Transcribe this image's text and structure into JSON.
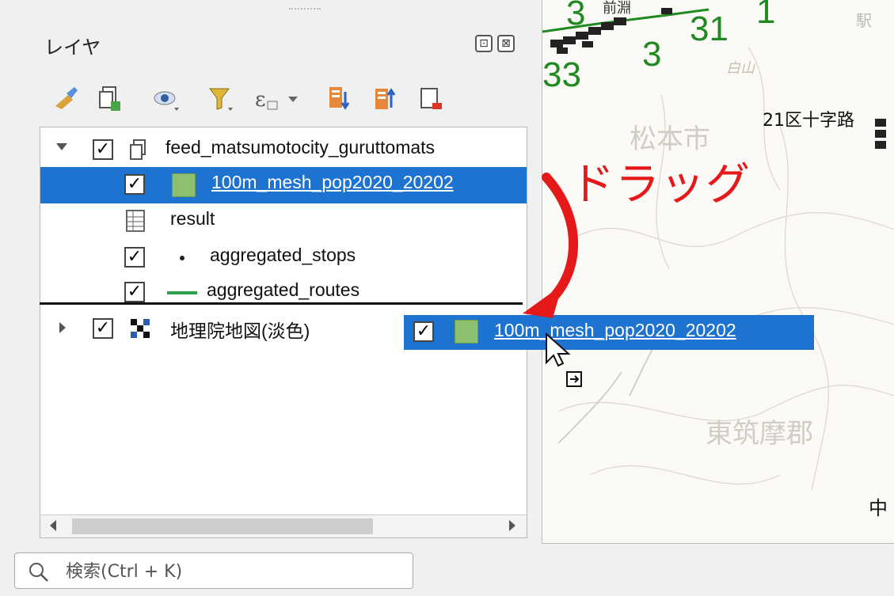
{
  "panel": {
    "title": "レイヤ",
    "dock_buttons": [
      "⊡",
      "⊠"
    ]
  },
  "toolbar": {
    "icons": [
      "style-manager-icon",
      "add-group-icon",
      "visibility-icon",
      "filter-icon",
      "expression-filter-icon",
      "expand-all-icon",
      "collapse-all-icon",
      "remove-layer-icon"
    ]
  },
  "layers": [
    {
      "name": "feed_matsumotocity_guruttomats",
      "checked": true,
      "expanded": true,
      "type": "group"
    },
    {
      "name": "100m_mesh_pop2020_20202",
      "checked": true,
      "type": "polygon",
      "selected": true
    },
    {
      "name": "result",
      "checked": false,
      "type": "table"
    },
    {
      "name": "aggregated_stops",
      "checked": true,
      "type": "point"
    },
    {
      "name": "aggregated_routes",
      "checked": true,
      "type": "line"
    },
    {
      "name": "地理院地図(淡色)",
      "checked": true,
      "expanded": false,
      "type": "raster"
    }
  ],
  "drag": {
    "label": "ドラッグ",
    "ghost_name": "100m_mesh_pop2020_20202",
    "ghost_checked": true
  },
  "search": {
    "placeholder": "検索(Ctrl + K)"
  },
  "map": {
    "labels": {
      "area_1": "21区十字路",
      "city": "松本市",
      "district": "東筑摩郡",
      "mountain": "白山",
      "edge": "中",
      "station": "駅",
      "top": "前淵"
    },
    "route_numbers": [
      "3",
      "3",
      "31",
      "33",
      "1"
    ],
    "colors": {
      "route": "#1f8a1f",
      "selection": "#1e73d0",
      "arrow": "#e51919"
    }
  }
}
